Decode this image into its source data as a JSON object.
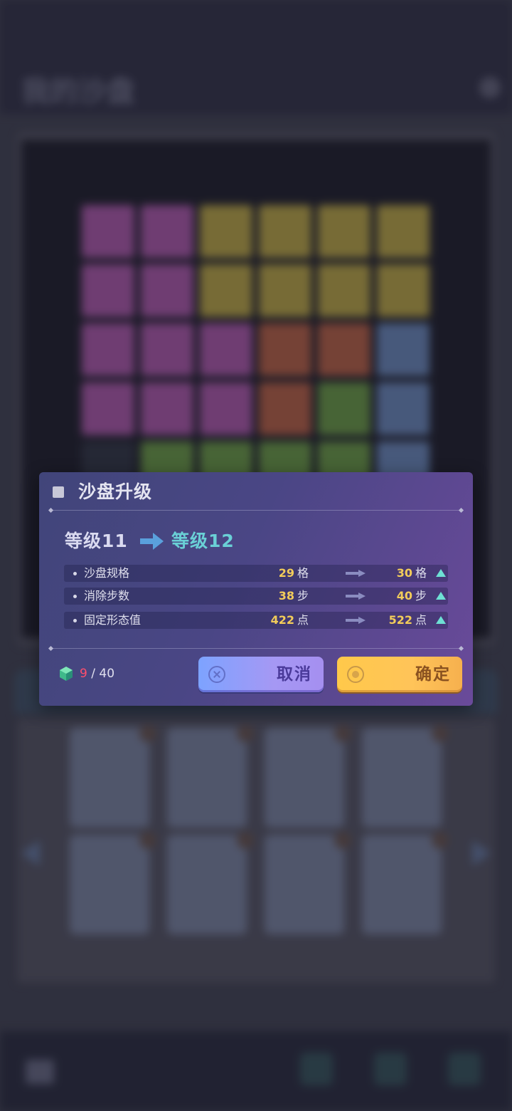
{
  "background": {
    "title": "我的沙盘"
  },
  "dialog": {
    "title": "沙盘升级",
    "level_from": "等级11",
    "level_to": "等级12",
    "stats": [
      {
        "label": "沙盘规格",
        "from": "29",
        "to": "30",
        "unit": "格"
      },
      {
        "label": "消除步数",
        "from": "38",
        "to": "40",
        "unit": "步"
      },
      {
        "label": "固定形态值",
        "from": "422",
        "to": "522",
        "unit": "点"
      }
    ],
    "resource": {
      "current": "9",
      "separator": " / ",
      "total": "40"
    },
    "cancel_label": "取消",
    "confirm_label": "确定"
  },
  "colors": {
    "accent_cyan": "#6ad0d6",
    "value_gold": "#f2cc5a",
    "resource_current": "#ff4f6d",
    "cancel_button": "#a598f4",
    "confirm_button": "#ffc459"
  },
  "icons": [
    "gear-icon",
    "arrow-right-icon",
    "triangle-up-icon",
    "cube-icon",
    "close-circle-icon",
    "confirm-circle-icon",
    "back-arrow-icon",
    "chevron-left-icon",
    "chevron-right-icon"
  ]
}
